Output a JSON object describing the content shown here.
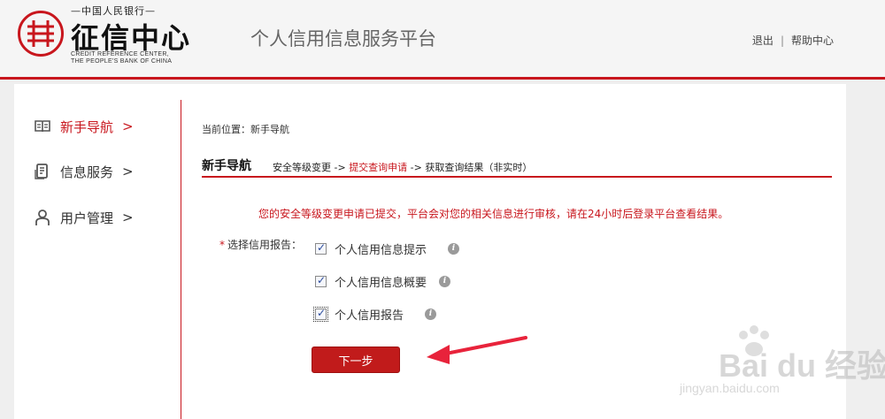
{
  "header": {
    "logo_top": "—中国人民银行—",
    "logo_main": "征信中心",
    "logo_en_1": "CREDIT REFERENCE CENTER,",
    "logo_en_2": "THE PEOPLE'S BANK OF CHINA",
    "platform_title": "个人信用信息服务平台",
    "links": {
      "logout": "退出",
      "separator": "|",
      "help": "帮助中心"
    }
  },
  "sidebar": {
    "items": [
      {
        "label": "新手导航",
        "arrow": ">",
        "icon": "book-icon",
        "active": true
      },
      {
        "label": "信息服务",
        "arrow": ">",
        "icon": "document-icon",
        "active": false
      },
      {
        "label": "用户管理",
        "arrow": ">",
        "icon": "user-icon",
        "active": false
      }
    ]
  },
  "main": {
    "breadcrumb": "当前位置：新手导航",
    "section_title": "新手导航",
    "steps": {
      "step1": "安全等级变更",
      "sep1": " -> ",
      "step2": "提交查询申请",
      "sep2": " -> ",
      "step3": "获取查询结果（非实时）"
    },
    "notice": "您的安全等级变更申请已提交，平台会对您的相关信息进行审核，请在24小时后登录平台查看结果。",
    "field_label": "选择信用报告：",
    "required_mark": "*",
    "options": [
      {
        "label": "个人信用信息提示",
        "checked": true
      },
      {
        "label": "个人信用信息概要",
        "checked": true
      },
      {
        "label": "个人信用报告",
        "checked": true
      }
    ],
    "info_glyph": "i",
    "next_button": "下一步"
  },
  "watermark": {
    "text": "Bai du 经验",
    "url": "jingyan.baidu.com"
  },
  "colors": {
    "brand_red": "#c8161d",
    "button_red": "#c11b1b",
    "annotation_arrow": "#e8233b"
  }
}
